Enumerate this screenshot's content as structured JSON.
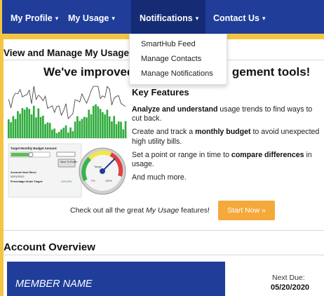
{
  "nav": {
    "items": [
      {
        "label": "My Profile",
        "caret": "▾"
      },
      {
        "label": "My Usage",
        "caret": "▾"
      },
      {
        "label": "Notifications",
        "caret": "▾"
      },
      {
        "label": "Contact Us",
        "caret": "▾"
      }
    ],
    "active": "Notifications"
  },
  "dropdown": {
    "items": [
      "SmartHub Feed",
      "Manage Contacts",
      "Manage Notifications"
    ]
  },
  "section_view": {
    "title": "View and Manage My Usage"
  },
  "promo": {
    "heading_part1": "We've improved",
    "heading_part2": "gement tools!",
    "key_features_title": "Key Features",
    "features": [
      {
        "bold": "Analyze and understand",
        "rest": " usage trends to find ways to cut back."
      },
      {
        "pre": "Create and track a ",
        "bold": "monthly budget",
        "rest": " to avoid unexpected high utility bills."
      },
      {
        "pre": "Set a point or range in time to ",
        "bold": "compare differences",
        "rest": " in usage."
      },
      {
        "pre": "And much more.",
        "bold": "",
        "rest": ""
      }
    ],
    "cta_pre": "Check out all the great ",
    "cta_em": "My Usage",
    "cta_post": " features!",
    "start_button": "Start Now »"
  },
  "thumbnail": {
    "target_budget_label": "Target Monthly Budget Amount:",
    "save_label": "Save To Profile",
    "account_used_label": "Account Used Since",
    "account_date": "02/01/2012:",
    "percentage_label": "Percentage Under Target:",
    "percentage_value": "-100.00%",
    "gauge_label": "Target",
    "gauge_pct_left": "0%",
    "gauge_pct_right": "100%"
  },
  "section_account": {
    "title": "Account Overview"
  },
  "member": {
    "name": "MEMBER NAME"
  },
  "due": {
    "label": "Next Due:",
    "date": "05/20/2020"
  },
  "colors": {
    "nav": "#1f3d99",
    "accent": "#f4a93a",
    "frame": "#f5c542"
  }
}
